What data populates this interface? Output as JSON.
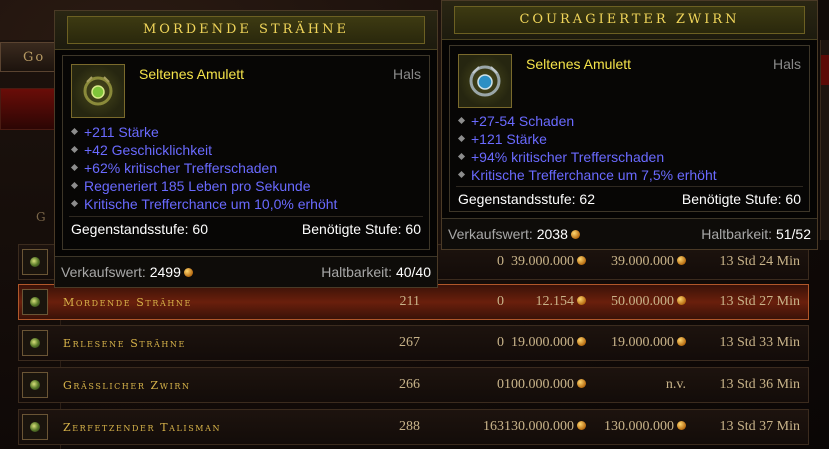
{
  "background": {
    "left_tab_label": "Go",
    "left_label_g": "G"
  },
  "rows": [
    {
      "name": "",
      "level": "",
      "bid": "0",
      "buyout_a": "39.000.000",
      "buyout_b": "39.000.000",
      "time": "13 Std 24 Min",
      "selected": false
    },
    {
      "name": "Mordende Strähne",
      "level": "211",
      "bid": "0",
      "buyout_a": "12.154",
      "buyout_b": "50.000.000",
      "time": "13 Std 27 Min",
      "selected": true
    },
    {
      "name": "Erlesene Strähne",
      "level": "267",
      "bid": "0",
      "buyout_a": "19.000.000",
      "buyout_b": "19.000.000",
      "time": "13 Std 33 Min",
      "selected": false
    },
    {
      "name": "Grässlicher Zwirn",
      "level": "266",
      "bid": "0",
      "buyout_a": "100.000.000",
      "buyout_b": "n.v.",
      "time": "13 Std 36 Min",
      "selected": false
    },
    {
      "name": "Zerfetzender Talisman",
      "level": "288",
      "bid": "163",
      "buyout_a": "130.000.000",
      "buyout_b": "130.000.000",
      "time": "13 Std 37 Min",
      "selected": false
    }
  ],
  "tooltip_left": {
    "title": "MORDENDE STRÄHNE",
    "type": "Seltenes Amulett",
    "slot": "Hals",
    "icon": "amulet-icon",
    "affixes": [
      "+211 Stärke",
      "+42 Geschicklichkeit",
      "+62% kritischer Trefferschaden",
      "Regeneriert 185 Leben pro Sekunde",
      "Kritische Trefferchance um 10,0% erhöht"
    ],
    "item_level_label": "Gegenstandsstufe: 60",
    "required_level_label": "Benötigte Stufe: 60",
    "sell_label": "Verkaufswert:",
    "sell_value": "2499",
    "durability_label": "Haltbarkeit:",
    "durability_value": "40/40"
  },
  "tooltip_right": {
    "title": "COURAGIERTER ZWIRN",
    "type": "Seltenes Amulett",
    "slot": "Hals",
    "icon": "amulet-icon",
    "affixes": [
      "+27-54 Schaden",
      "+121 Stärke",
      "+94% kritischer Trefferschaden",
      "Kritische Trefferchance um 7,5% erhöht"
    ],
    "item_level_label": "Gegenstandsstufe: 62",
    "required_level_label": "Benötigte Stufe: 60",
    "sell_label": "Verkaufswert:",
    "sell_value": "2038",
    "durability_label": "Haltbarkeit:",
    "durability_value": "51/52"
  },
  "colors": {
    "affix_blue": "#6a6aff",
    "item_yellow": "#f5e44a",
    "row_gold": "#d8b44a"
  }
}
